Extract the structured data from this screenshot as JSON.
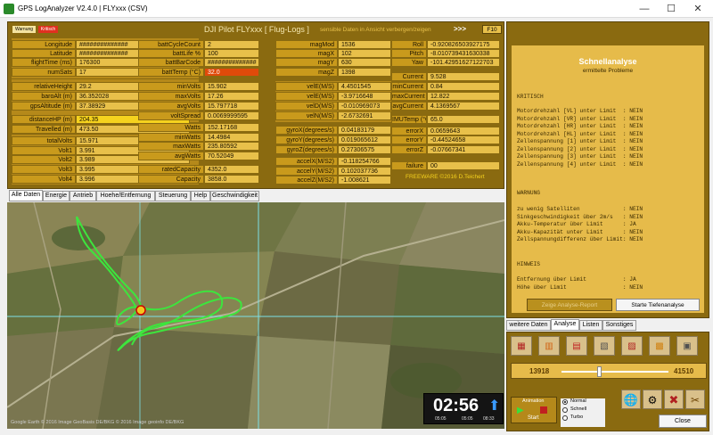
{
  "window": {
    "title": "GPS LogAnalyzer V2.4.0  |  FLYxxx (CSV)",
    "minimize": "—",
    "maximize": "☐",
    "close": "✕"
  },
  "header": {
    "warnung": "Warnung",
    "kritisch": "Kritisch",
    "title": "DJI Pilot FLYxxx [ Flug-Logs ]",
    "hint": "sensible Daten in Ansicht verbergen/zeigen",
    "arrows": ">>>",
    "f10": "F10"
  },
  "col1": [
    {
      "label": "Longitude",
      "value": "##############"
    },
    {
      "label": "Latitude",
      "value": "##############"
    },
    {
      "label": "flightTime (ms)",
      "value": "176300"
    },
    {
      "label": "numSats",
      "value": "17"
    },
    {
      "label": "relativeHeight",
      "value": "29.2"
    },
    {
      "label": "baroAlt (m)",
      "value": "36.352028"
    },
    {
      "label": "gpsAltitude (m)",
      "value": "37.38929"
    },
    {
      "label": "distanceHP (m)",
      "value": "204.35"
    },
    {
      "label": "Travelled (m)",
      "value": "473.50"
    },
    {
      "label": "totalVolts",
      "value": "15.971"
    },
    {
      "label": "Volt1",
      "value": "3.991"
    },
    {
      "label": "Volt2",
      "value": "3.989"
    },
    {
      "label": "Volt3",
      "value": "3.995"
    },
    {
      "label": "Volt4",
      "value": "3.996"
    }
  ],
  "col2": [
    {
      "label": "battCycleCount",
      "value": "2"
    },
    {
      "label": "battLife %",
      "value": "100"
    },
    {
      "label": "battBarCode",
      "value": "##############"
    },
    {
      "label": "battTemp (°C)",
      "value": "32.0"
    },
    {
      "label": "minVolts",
      "value": "15.902"
    },
    {
      "label": "maxVolts",
      "value": "17.26"
    },
    {
      "label": "avgVolts",
      "value": "15.797718"
    },
    {
      "label": "voltSpread",
      "value": "0.0069999595"
    },
    {
      "label": "Watts",
      "value": "152.17168"
    },
    {
      "label": "minWatts",
      "value": "14.4984"
    },
    {
      "label": "maxWatts",
      "value": "235.80592"
    },
    {
      "label": "avgWatts",
      "value": "70.52049"
    },
    {
      "label": "ratedCapacity",
      "value": "4352.0"
    },
    {
      "label": "Capacity",
      "value": "3858.0"
    }
  ],
  "col3": [
    {
      "label": "magMod",
      "value": "1536"
    },
    {
      "label": "magX",
      "value": "102"
    },
    {
      "label": "magY",
      "value": "630"
    },
    {
      "label": "magZ",
      "value": "1398"
    },
    {
      "label": "velE(M/S)",
      "value": "4.4501545"
    },
    {
      "label": "velE(M/S)",
      "value": "-3.9716648"
    },
    {
      "label": "velD(M/S)",
      "value": "-0.010969073"
    },
    {
      "label": "velN(M/S)",
      "value": "-2.6732691"
    },
    {
      "label": "gyroX(degrees/s)",
      "value": "0.04183179"
    },
    {
      "label": "gyroY(degrees/s)",
      "value": "0.019065612"
    },
    {
      "label": "gyroZ(degrees/s)",
      "value": "0.27306575"
    },
    {
      "label": "accelX(M/S2)",
      "value": "-0.118254766"
    },
    {
      "label": "accelY(M/S2)",
      "value": "0.102037736"
    },
    {
      "label": "accelZ(M/S2)",
      "value": "-1.008621"
    }
  ],
  "col4": [
    {
      "label": "Roll",
      "value": "-0.920826503927175"
    },
    {
      "label": "Pitch",
      "value": "-8.010739431630338"
    },
    {
      "label": "Yaw",
      "value": "-101.42951627122703"
    },
    {
      "label": "Current",
      "value": "9.528"
    },
    {
      "label": "minCurrent",
      "value": "0.84"
    },
    {
      "label": "maxCurrent",
      "value": "12.822"
    },
    {
      "label": "avgCurrent",
      "value": "4.1369567"
    },
    {
      "label": "IMUTemp (°C)",
      "value": "65.0"
    },
    {
      "label": "errorX",
      "value": "0.0659643"
    },
    {
      "label": "errorY",
      "value": "-0.44524658"
    },
    {
      "label": "errorZ",
      "value": "-0.07667341"
    },
    {
      "label": "failure",
      "value": "00"
    }
  ],
  "freeware": "FREEWARE ©2016 D.Teichert",
  "tabs": [
    "Alle Daten",
    "Energie",
    "Antrieb",
    "Hoehe/Entfernung",
    "Steuerung",
    "Help",
    "Geschwindigkeit"
  ],
  "map": {
    "time": "02:56",
    "t_start": "05:05",
    "t_end": "05:05",
    "t_mid": "08:33",
    "copyright": "Google Earth  © 2016 Image  GeoBasis DE/BKG  © 2016 Image geoinfo DE/BKG"
  },
  "analysis": {
    "title": "Schnellanalyse",
    "subtitle": "ermittelte Probleme",
    "kritisch": "KRITISCH",
    "kritisch_items": [
      "Motordrehzahl [VL] unter Limit  : NEIN",
      "Motordrehzahl [VR] unter Limit  : NEIN",
      "Motordrehzahl [HR] unter Limit  : NEIN",
      "Motordrehzahl [HL] unter Limit  : NEIN",
      "Zellenspannung [1] unter Limit  : NEIN",
      "Zellenspannung [2] unter Limit  : NEIN",
      "Zellenspannung [3] unter Limit  : NEIN",
      "Zellenspannung [4] unter Limit  : NEIN"
    ],
    "warnung": "WARNUNG",
    "warnung_items": [
      "zu wenig Satelliten             : NEIN",
      "Sinkgeschwindigkeit über 2m/s   : NEIN",
      "Akku-Temperatur über Limit      : JA",
      "Akku-Kapazität unter Limit      : NEIN",
      "Zellspannungdifferenz über Limit: NEIN"
    ],
    "hinweis": "HINWEIS",
    "hinweis_items": [
      "Entfernung über Limit           : JA",
      "Höhe über Limit                 : NEIN"
    ],
    "report_button": "Zeige Analyse-Report",
    "deep_button": "Starte Tiefenanalyse"
  },
  "rtabs": [
    "weitere Daten",
    "Analyse",
    "Listen",
    "Sonstiges"
  ],
  "slider": {
    "min": "13918",
    "max": "41510",
    "position": 0.33
  },
  "icon_labels": [
    "Einstellungen",
    "Speichern",
    "Kamera",
    "Bericht",
    "Export",
    "Akkus",
    "Gimbal"
  ],
  "animation": {
    "label": "Animation",
    "start": "Start",
    "modes": [
      "Normal",
      "Schnell",
      "Turbo"
    ],
    "selected": "Normal"
  },
  "close": "Close"
}
